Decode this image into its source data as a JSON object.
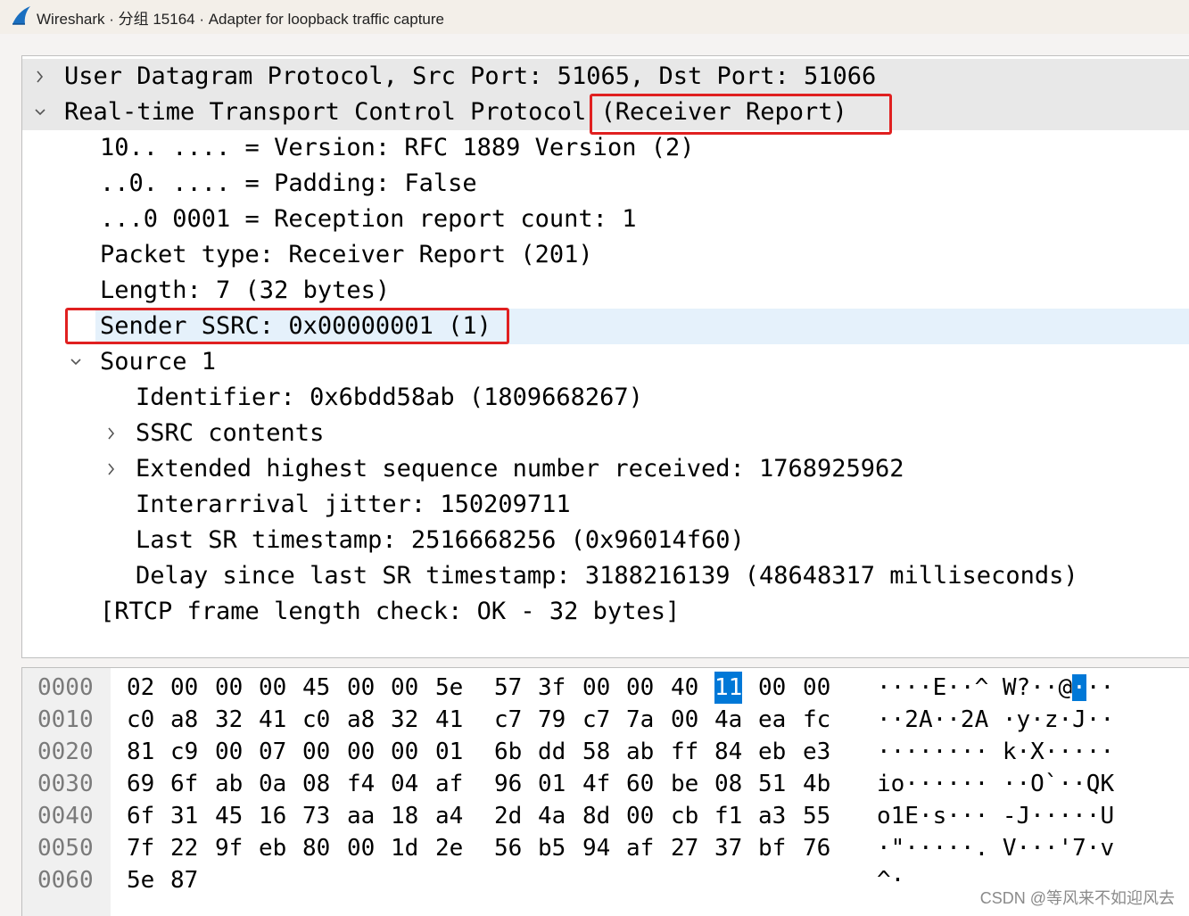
{
  "window": {
    "title": "Wireshark · 分组 15164 · Adapter for loopback traffic capture"
  },
  "details": {
    "rows": [
      {
        "text": "User Datagram Protocol, Src Port: 51065, Dst Port: 51066",
        "expander": "collapsed"
      },
      {
        "text": "Real-time Transport Control Protocol (Receiver Report)",
        "expander": "expanded"
      },
      {
        "text": "10.. .... = Version: RFC 1889 Version (2)",
        "expander": "none"
      },
      {
        "text": "..0. .... = Padding: False",
        "expander": "none"
      },
      {
        "text": "...0 0001 = Reception report count: 1",
        "expander": "none"
      },
      {
        "text": "Packet type: Receiver Report (201)",
        "expander": "none"
      },
      {
        "text": "Length: 7 (32 bytes)",
        "expander": "none"
      },
      {
        "text": "Sender SSRC: 0x00000001 (1)",
        "expander": "none",
        "selected": true
      },
      {
        "text": "Source 1",
        "expander": "expanded"
      },
      {
        "text": "Identifier: 0x6bdd58ab (1809668267)",
        "expander": "none"
      },
      {
        "text": "SSRC contents",
        "expander": "collapsed"
      },
      {
        "text": "Extended highest sequence number received: 1768925962",
        "expander": "collapsed"
      },
      {
        "text": "Interarrival jitter: 150209711",
        "expander": "none"
      },
      {
        "text": "Last SR timestamp: 2516668256 (0x96014f60)",
        "expander": "none"
      },
      {
        "text": "Delay since last SR timestamp: 3188216139 (48648317 milliseconds)",
        "expander": "none"
      },
      {
        "text": "[RTCP frame length check: OK - 32 bytes]",
        "expander": "none"
      }
    ]
  },
  "bytes": {
    "lines": [
      {
        "offset": "0000",
        "hex": [
          "02",
          "00",
          "00",
          "00",
          "45",
          "00",
          "00",
          "5e",
          "57",
          "3f",
          "00",
          "00",
          "40",
          "11",
          "00",
          "00"
        ],
        "ascii": "····E··^ W?··@···",
        "selected_hex": 13,
        "selected_ascii": 13
      },
      {
        "offset": "0010",
        "hex": [
          "c0",
          "a8",
          "32",
          "41",
          "c0",
          "a8",
          "32",
          "41",
          "c7",
          "79",
          "c7",
          "7a",
          "00",
          "4a",
          "ea",
          "fc"
        ],
        "ascii": "··2A··2A ·y·z·J··"
      },
      {
        "offset": "0020",
        "hex": [
          "81",
          "c9",
          "00",
          "07",
          "00",
          "00",
          "00",
          "01",
          "6b",
          "dd",
          "58",
          "ab",
          "ff",
          "84",
          "eb",
          "e3"
        ],
        "ascii": "········ k·X·····"
      },
      {
        "offset": "0030",
        "hex": [
          "69",
          "6f",
          "ab",
          "0a",
          "08",
          "f4",
          "04",
          "af",
          "96",
          "01",
          "4f",
          "60",
          "be",
          "08",
          "51",
          "4b"
        ],
        "ascii": "io······ ··O`··QK"
      },
      {
        "offset": "0040",
        "hex": [
          "6f",
          "31",
          "45",
          "16",
          "73",
          "aa",
          "18",
          "a4",
          "2d",
          "4a",
          "8d",
          "00",
          "cb",
          "f1",
          "a3",
          "55"
        ],
        "ascii": "o1E·s··· -J·····U"
      },
      {
        "offset": "0050",
        "hex": [
          "7f",
          "22",
          "9f",
          "eb",
          "80",
          "00",
          "1d",
          "2e",
          "56",
          "b5",
          "94",
          "af",
          "27",
          "37",
          "bf",
          "76"
        ],
        "ascii": "·\"·····. V···'7·v"
      },
      {
        "offset": "0060",
        "hex": [
          "5e",
          "87"
        ],
        "ascii": "^·"
      }
    ]
  },
  "watermark": "CSDN @等风来不如迎风去",
  "colors": {
    "annotation_box": "#e02020",
    "selection": "#0078d7",
    "row_highlight": "#e5f1fb"
  }
}
